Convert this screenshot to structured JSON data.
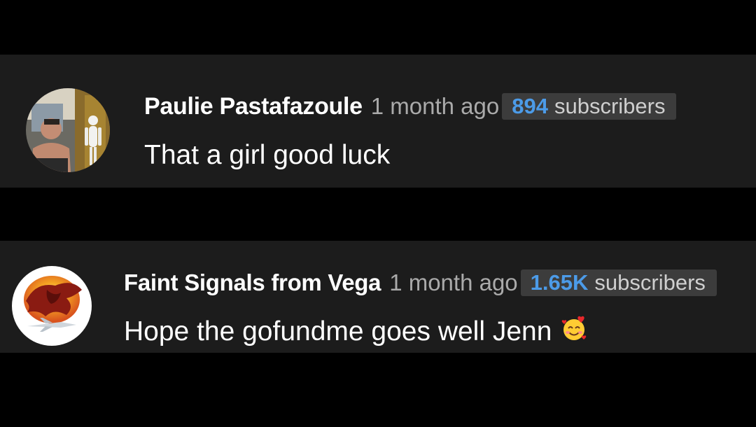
{
  "comments": [
    {
      "author": "Paulie Pastafazoule",
      "timestamp": "1 month ago",
      "subscriber_count": "894",
      "subscriber_label": "subscribers",
      "text": "That a girl good luck",
      "avatar_icon": "user-photo-avatar"
    },
    {
      "author": "Faint Signals from Vega",
      "timestamp": "1 month ago",
      "subscriber_count": "1.65K",
      "subscriber_label": "subscribers",
      "text": "Hope the gofundme goes well Jenn",
      "emoji_icon": "smiling-face-with-hearts-icon",
      "avatar_icon": "dragon-logo-avatar"
    }
  ],
  "colors": {
    "page_background": "#000000",
    "card_background": "#1c1c1c",
    "author_text": "#ffffff",
    "timestamp_text": "#aaaaaa",
    "badge_background": "#3c3c3c",
    "subscriber_count": "#4c9be8",
    "comment_text": "#ffffff"
  }
}
